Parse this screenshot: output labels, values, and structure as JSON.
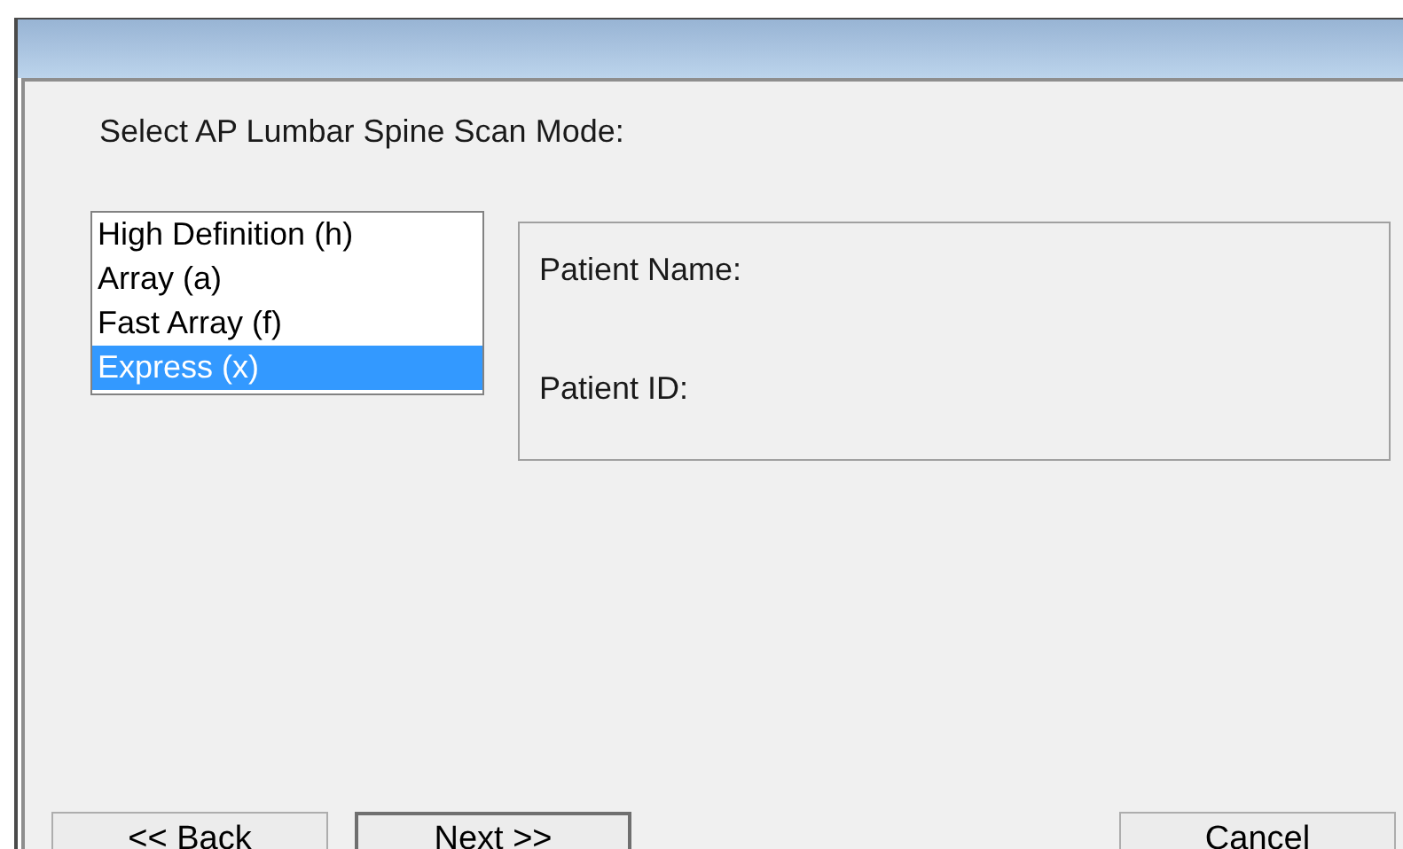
{
  "prompt": "Select AP Lumbar Spine Scan Mode:",
  "scan_modes": [
    {
      "label": "High Definition (h)",
      "selected": false
    },
    {
      "label": "Array (a)",
      "selected": false
    },
    {
      "label": "Fast Array (f)",
      "selected": false
    },
    {
      "label": "Express (x)",
      "selected": true
    }
  ],
  "patient": {
    "name_label": "Patient Name:",
    "id_label": "Patient ID:"
  },
  "buttons": [
    {
      "label": "<< Back",
      "default": false
    },
    {
      "label": "Next >>",
      "default": true
    },
    {
      "label": "Cancel",
      "default": false
    }
  ]
}
